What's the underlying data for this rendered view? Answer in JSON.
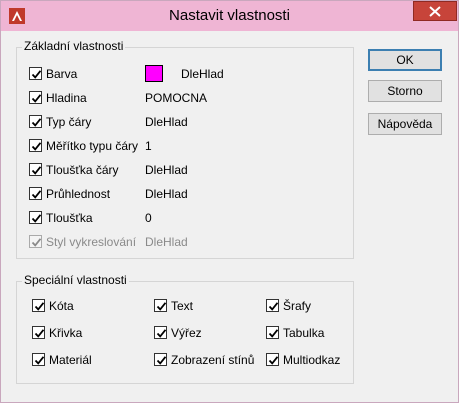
{
  "window": {
    "title": "Nastavit vlastnosti"
  },
  "colors": {
    "titlebar": "#efb5d4",
    "close": "#c7443a",
    "swatch": "#ff00ff"
  },
  "basic": {
    "group_label": "Základní vlastnosti",
    "rows": [
      {
        "label": "Barva",
        "value": "DleHlad",
        "checked": true,
        "enabled": true
      },
      {
        "label": "Hladina",
        "value": "POMOCNA",
        "checked": true,
        "enabled": true
      },
      {
        "label": "Typ čáry",
        "value": "DleHlad",
        "checked": true,
        "enabled": true
      },
      {
        "label": "Měřítko typu čáry",
        "value": "1",
        "checked": true,
        "enabled": true
      },
      {
        "label": "Tloušťka čáry",
        "value": "DleHlad",
        "checked": true,
        "enabled": true
      },
      {
        "label": "Průhlednost",
        "value": "DleHlad",
        "checked": true,
        "enabled": true
      },
      {
        "label": "Tloušťka",
        "value": "0",
        "checked": true,
        "enabled": true
      },
      {
        "label": "Styl vykreslování",
        "value": "DleHlad",
        "checked": true,
        "enabled": false
      }
    ]
  },
  "special": {
    "group_label": "Speciální vlastnosti",
    "items": [
      {
        "label": "Kóta",
        "checked": true
      },
      {
        "label": "Text",
        "checked": true
      },
      {
        "label": "Šrafy",
        "checked": true
      },
      {
        "label": "Křivka",
        "checked": true
      },
      {
        "label": "Výřez",
        "checked": true
      },
      {
        "label": "Tabulka",
        "checked": true
      },
      {
        "label": "Materiál",
        "checked": true
      },
      {
        "label": "Zobrazení stínů",
        "checked": true
      },
      {
        "label": "Multiodkaz",
        "checked": true
      }
    ]
  },
  "buttons": {
    "ok": "OK",
    "cancel": "Storno",
    "help": "Nápověda"
  }
}
